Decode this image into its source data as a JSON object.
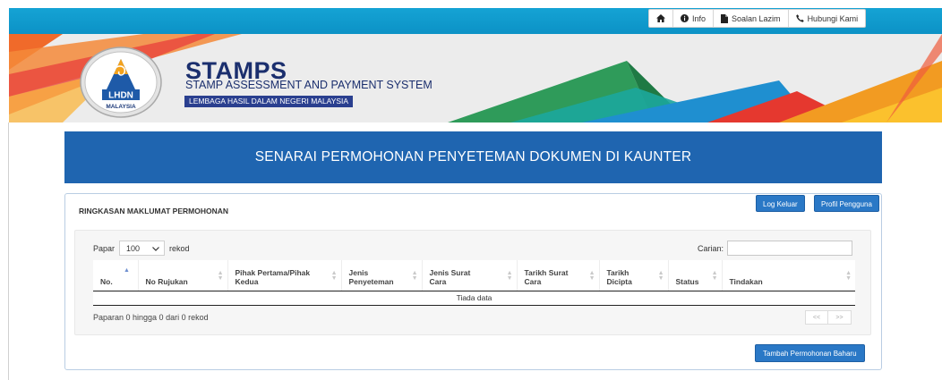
{
  "topnav": {
    "items": [
      {
        "label": "",
        "icon": "home-icon"
      },
      {
        "label": "Info",
        "icon": "info-icon"
      },
      {
        "label": "Soalan Lazim",
        "icon": "document-icon"
      },
      {
        "label": "Hubungi Kami",
        "icon": "phone-icon"
      }
    ]
  },
  "brand": {
    "title": "STAMPS",
    "subtitle": "STAMP ASSESSMENT AND PAYMENT SYSTEM",
    "tagline": "LEMBAGA HASIL DALAM NEGERI MALAYSIA",
    "logo_text_top": "LHDN",
    "logo_text_bottom": "MALAYSIA"
  },
  "heading": "SENARAI PERMOHONAN PENYETEMAN DOKUMEN DI KAUNTER",
  "panel": {
    "title": "RINGKASAN MAKLUMAT PERMOHONAN",
    "logout_label": "Log Keluar",
    "profile_label": "Profil Pengguna",
    "add_label": "Tambah Permohonan Baharu"
  },
  "table_controls": {
    "show_prefix": "Papar",
    "show_value": "100",
    "show_suffix": "rekod",
    "search_label": "Carian:",
    "search_value": ""
  },
  "table": {
    "columns": [
      {
        "label": "No."
      },
      {
        "label": "No Rujukan"
      },
      {
        "label": "Pihak Pertama/Pihak Kedua"
      },
      {
        "label": "Jenis Penyeteman"
      },
      {
        "label": "Jenis Surat Cara"
      },
      {
        "label": "Tarikh Surat Cara"
      },
      {
        "label": "Tarikh Dicipta"
      },
      {
        "label": "Status"
      },
      {
        "label": "Tindakan"
      }
    ],
    "empty_text": "Tiada data",
    "info_text": "Paparan 0 hingga 0 dari 0 rekod",
    "prev_label": "<<",
    "next_label": ">>"
  },
  "colors": {
    "topbar": "#0c92c6",
    "heading": "#1f65b0",
    "brand_navy": "#1b2f6e",
    "button": "#2a78c6"
  }
}
